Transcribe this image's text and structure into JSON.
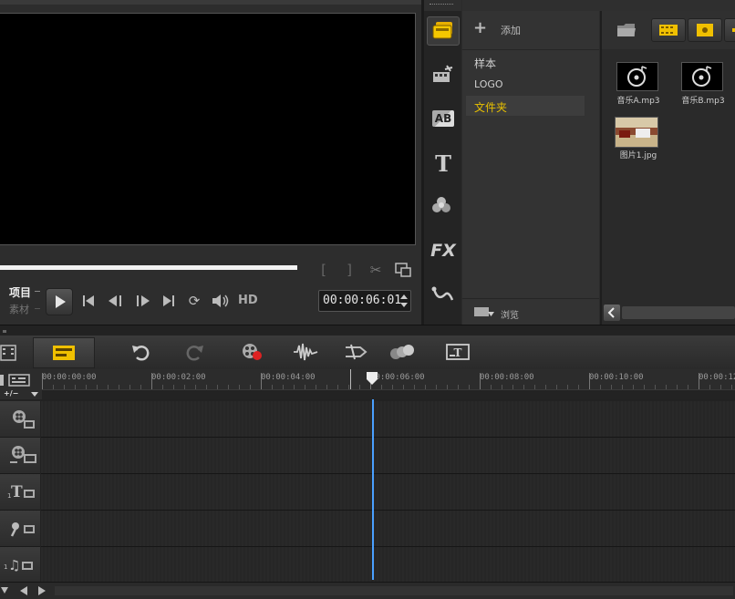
{
  "player": {
    "project_label": "项目",
    "clip_label": "素材",
    "hd_label": "HD",
    "timecode": "00:00:06:01",
    "progress": 1.0
  },
  "library": {
    "add_label": "添加",
    "folders": [
      "样本",
      "LOGO",
      "文件夹"
    ],
    "selected_folder": "文件夹",
    "browse_label": "浏览",
    "items": [
      {
        "name": "音乐A.mp3",
        "type": "audio"
      },
      {
        "name": "音乐B.mp3",
        "type": "audio"
      },
      {
        "name": "图片1.jpg",
        "type": "image"
      }
    ]
  },
  "sidebar_tabs": [
    "media",
    "instant-project",
    "transition",
    "title",
    "graphics",
    "filter",
    "path"
  ],
  "sidebar_fx_label": "FX",
  "sidebar_ab_label": "AB",
  "sidebar_t_label": "T",
  "timeline": {
    "zoom_label": "+/−",
    "ruler": [
      "00:00:00:00",
      "00:00:02:00",
      "00:00:04:00",
      "00:00:06:00",
      "00:00:08:00",
      "00:00:10:00",
      "00:00:12"
    ],
    "playhead_time": "00:00:06:00",
    "tracks": [
      "video",
      "overlay",
      "title",
      "voice",
      "music"
    ]
  },
  "colors": {
    "accent_yellow": "#e8c000",
    "playhead_blue": "#4aa0ff",
    "selected_text": "#e8c000"
  }
}
